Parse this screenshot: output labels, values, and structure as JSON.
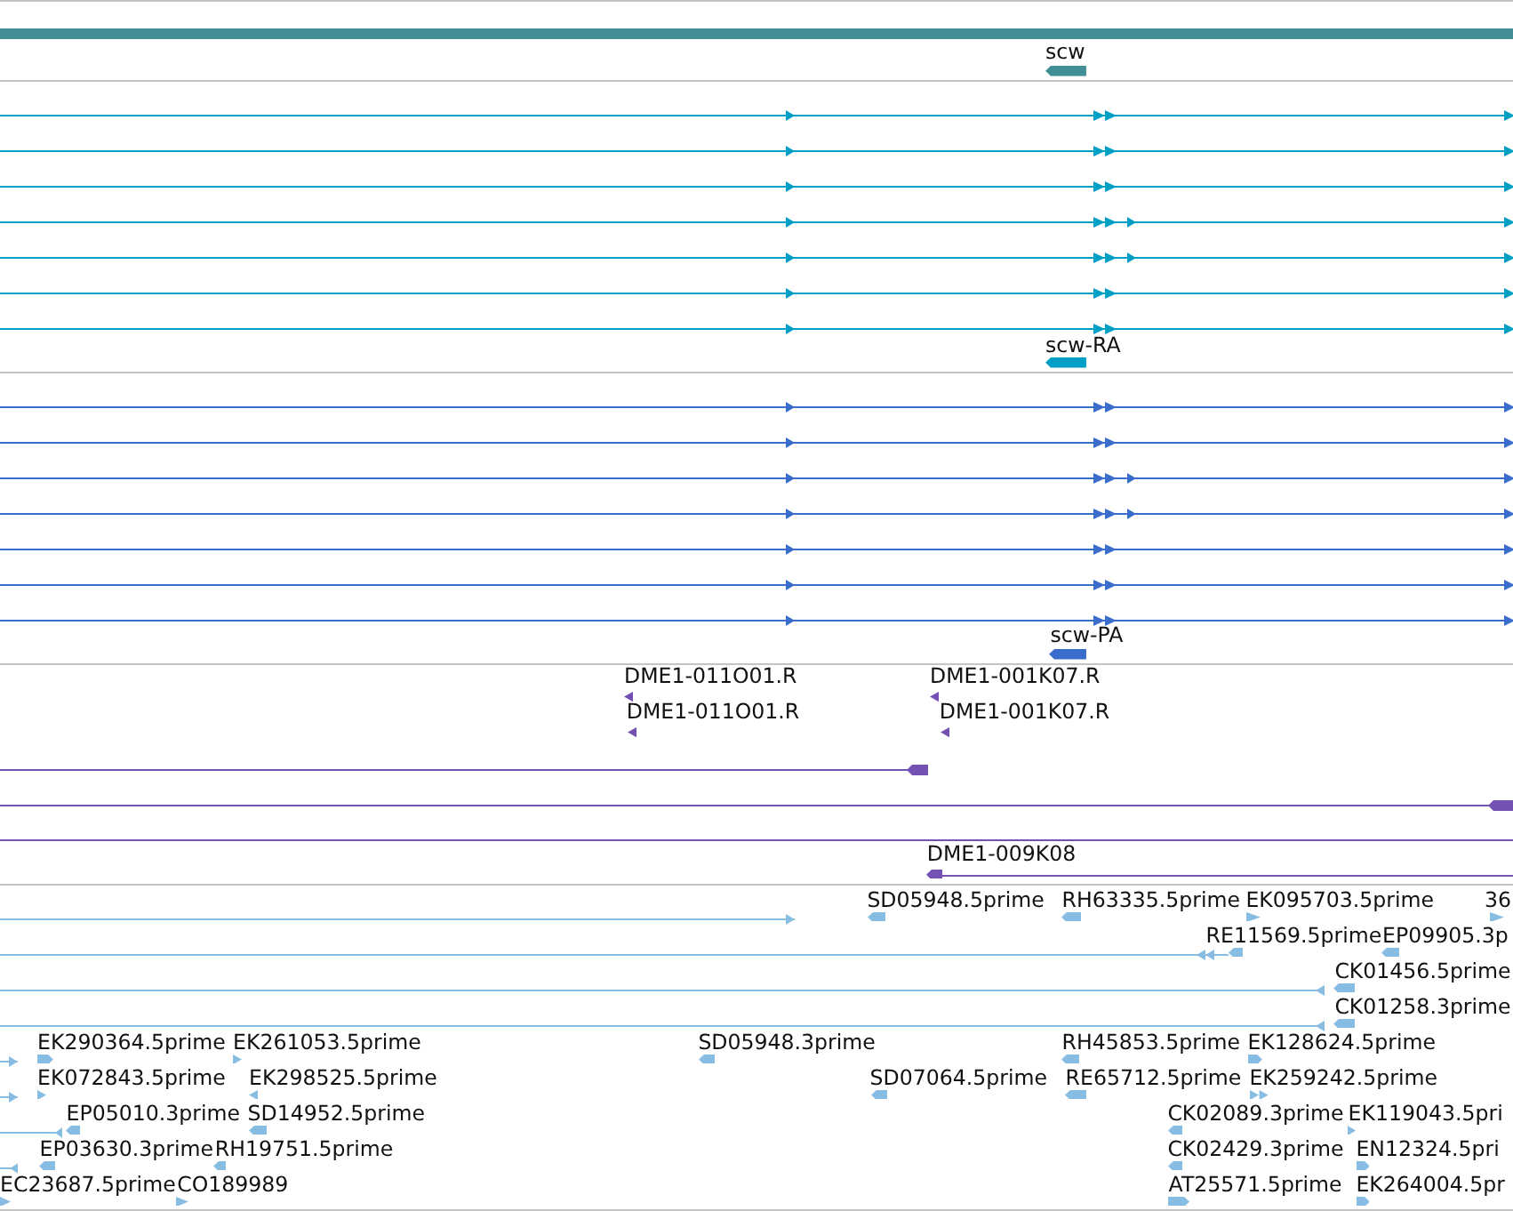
{
  "tracks": [
    {
      "color": "#418f94",
      "features": [
        {
          "kind": "bar"
        },
        {
          "kind": "tag",
          "label": "scw",
          "reverse_strand": true
        }
      ]
    },
    {
      "color": "#00a0c6",
      "features": [
        {
          "kind": "line",
          "reverse_strand": false
        },
        {
          "kind": "line",
          "reverse_strand": false
        },
        {
          "kind": "line",
          "reverse_strand": false
        },
        {
          "kind": "line",
          "reverse_strand": false
        },
        {
          "kind": "line",
          "reverse_strand": false
        },
        {
          "kind": "line",
          "reverse_strand": false
        },
        {
          "kind": "line",
          "reverse_strand": false
        },
        {
          "kind": "tag",
          "label": "scw-RA",
          "reverse_strand": true
        }
      ]
    },
    {
      "color": "#3a6ccc",
      "features": [
        {
          "kind": "line",
          "reverse_strand": false
        },
        {
          "kind": "line",
          "reverse_strand": false
        },
        {
          "kind": "line",
          "reverse_strand": false
        },
        {
          "kind": "line",
          "reverse_strand": false
        },
        {
          "kind": "line",
          "reverse_strand": false
        },
        {
          "kind": "line",
          "reverse_strand": false
        },
        {
          "kind": "line",
          "reverse_strand": false
        },
        {
          "kind": "tag",
          "label": "scw-PA",
          "reverse_strand": true
        }
      ]
    },
    {
      "color": "#7352b4",
      "features": [
        {
          "kind": "tag",
          "label": "DME1-011O01.R",
          "reverse_strand": true
        },
        {
          "kind": "tag",
          "label": "DME1-001K07.R",
          "reverse_strand": true
        },
        {
          "kind": "tag",
          "label": "DME1-011O01.R",
          "reverse_strand": true
        },
        {
          "kind": "tag",
          "label": "DME1-001K07.R",
          "reverse_strand": true
        },
        {
          "kind": "line",
          "reverse_strand": true
        },
        {
          "kind": "line",
          "reverse_strand": true
        },
        {
          "kind": "line"
        },
        {
          "kind": "tag",
          "label": "DME1-009K08",
          "reverse_strand": true
        },
        {
          "kind": "line"
        }
      ]
    },
    {
      "color": "#88bde3",
      "features": [
        {
          "kind": "line",
          "reverse_strand": false
        },
        {
          "kind": "tag",
          "label": "SD05948.5prime",
          "reverse_strand": true
        },
        {
          "kind": "tag",
          "label": "RH63335.5prime",
          "reverse_strand": true
        },
        {
          "kind": "tag",
          "label": "EK095703.5prime",
          "reverse_strand": false
        },
        {
          "kind": "tag",
          "label": "36",
          "reverse_strand": false
        },
        {
          "kind": "line",
          "reverse_strand": true
        },
        {
          "kind": "tag",
          "label": "RE11569.5prime",
          "reverse_strand": true
        },
        {
          "kind": "tag",
          "label": "EP09905.3p",
          "reverse_strand": true
        },
        {
          "kind": "line",
          "reverse_strand": true
        },
        {
          "kind": "tag",
          "label": "CK01456.5prime",
          "reverse_strand": true
        },
        {
          "kind": "line",
          "reverse_strand": true
        },
        {
          "kind": "tag",
          "label": "CK01258.3prime",
          "reverse_strand": true
        },
        {
          "kind": "line",
          "reverse_strand": false
        },
        {
          "kind": "tag",
          "label": "EK290364.5prime",
          "reverse_strand": false
        },
        {
          "kind": "tag",
          "label": "EK261053.5prime",
          "reverse_strand": false
        },
        {
          "kind": "tag",
          "label": "SD05948.3prime",
          "reverse_strand": true
        },
        {
          "kind": "tag",
          "label": "RH45853.5prime",
          "reverse_strand": true
        },
        {
          "kind": "tag",
          "label": "EK128624.5prime",
          "reverse_strand": false
        },
        {
          "kind": "line",
          "reverse_strand": false
        },
        {
          "kind": "tag",
          "label": "EK072843.5prime",
          "reverse_strand": false
        },
        {
          "kind": "tag",
          "label": "EK298525.5prime",
          "reverse_strand": true
        },
        {
          "kind": "tag",
          "label": "SD07064.5prime",
          "reverse_strand": true
        },
        {
          "kind": "tag",
          "label": "RE65712.5prime",
          "reverse_strand": true
        },
        {
          "kind": "tag",
          "label": "EK259242.5prime",
          "reverse_strand": false
        },
        {
          "kind": "line",
          "reverse_strand": true
        },
        {
          "kind": "tag",
          "label": "EP05010.3prime",
          "reverse_strand": true
        },
        {
          "kind": "tag",
          "label": "SD14952.5prime",
          "reverse_strand": true
        },
        {
          "kind": "tag",
          "label": "CK02089.3prime",
          "reverse_strand": true
        },
        {
          "kind": "tag",
          "label": "EK119043.5pri",
          "reverse_strand": false
        },
        {
          "kind": "line",
          "reverse_strand": true
        },
        {
          "kind": "tag",
          "label": "EP03630.3prime",
          "reverse_strand": true
        },
        {
          "kind": "tag",
          "label": "RH19751.5prime",
          "reverse_strand": true
        },
        {
          "kind": "tag",
          "label": "CK02429.3prime",
          "reverse_strand": true
        },
        {
          "kind": "tag",
          "label": "EN12324.5pri",
          "reverse_strand": false
        },
        {
          "kind": "tag",
          "label": "EC23687.5prime",
          "reverse_strand": false
        },
        {
          "kind": "tag",
          "label": "CO189989",
          "reverse_strand": false
        },
        {
          "kind": "tag",
          "label": "AT25571.5prime",
          "reverse_strand": false
        },
        {
          "kind": "tag",
          "label": "EK264004.5pr",
          "reverse_strand": false
        }
      ]
    }
  ]
}
